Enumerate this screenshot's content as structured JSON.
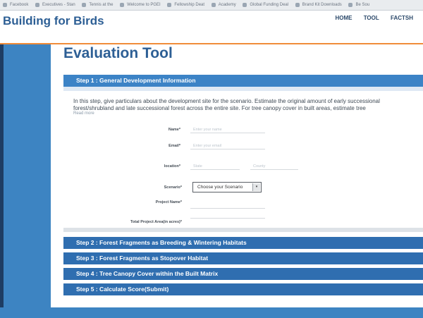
{
  "bookmarks": [
    "Facebook",
    "Executives - Stan",
    "Tennis at the",
    "Welcome to PGEI",
    "Fellowship Deat",
    "Academy",
    "Global Funding Deal",
    "Brand Kit Downloads",
    "Be Sou"
  ],
  "site": {
    "title": "Building for Birds",
    "nav": [
      "HOME",
      "TOOL",
      "FACTSH"
    ]
  },
  "page": {
    "title": "Evaluation Tool"
  },
  "step1": {
    "label": "Step 1 : General Development Information",
    "intro": "In this step, give particulars about the development site for the scenario. Estimate the original amount of early successional forest/shrubland and late successional forest across the entire site. For tree canopy cover in built areas, estimate tree",
    "read_more": "Read more"
  },
  "form": {
    "name_label": "Name*",
    "name_placeholder": "Enter your name",
    "email_label": "Email*",
    "email_placeholder": "Enter your email",
    "location_label": "location*",
    "location_placeholder_1": "State",
    "location_placeholder_2": "County",
    "scenario_label": "Scenario*",
    "scenario_value": "Choose your Scenario",
    "project_name_label": "Project Name*",
    "total_area_label": "Total Project Area(in acres)*"
  },
  "steps": [
    {
      "label": "Step 2 : Forest Fragments as Breeding & Wintering Habitats"
    },
    {
      "label": "Step 3 : Forest Fragments as Stopover Habitat"
    },
    {
      "label": "Step 4 : Tree Canopy Cover within the Built Matrix"
    },
    {
      "label": "Step 5 : Calculate Score(Submit)"
    }
  ],
  "colors": {
    "brand_blue": "#2d5f95",
    "step_blue": "#2f6eb0",
    "accent_orange": "#f08c3a"
  }
}
